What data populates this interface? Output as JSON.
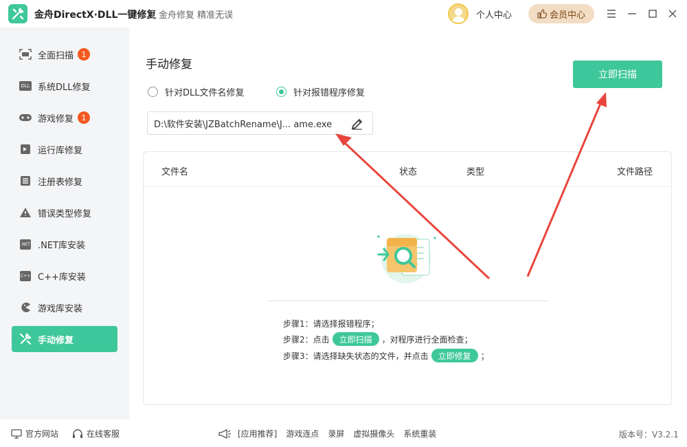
{
  "app": {
    "title": "金舟DirectX·DLL一键修复",
    "slogan": "金舟修复 精准无误",
    "user_center": "个人中心",
    "vip_label": "会员中心"
  },
  "sidebar": {
    "items": [
      {
        "label": "全面扫描",
        "icon": "scan-icon",
        "badge": "1"
      },
      {
        "label": "系统DLL修复",
        "icon": "dll-icon"
      },
      {
        "label": "游戏修复",
        "icon": "gamepad-icon",
        "badge": "1"
      },
      {
        "label": "运行库修复",
        "icon": "runtime-icon"
      },
      {
        "label": "注册表修复",
        "icon": "registry-icon"
      },
      {
        "label": "错误类型修复",
        "icon": "warning-icon"
      },
      {
        "label": ".NET库安装",
        "icon": "dotnet-icon"
      },
      {
        "label": "C++库安装",
        "icon": "cpp-icon"
      },
      {
        "label": "游戏库安装",
        "icon": "pacman-icon"
      },
      {
        "label": "手动修复",
        "icon": "wrench-icon",
        "active": true
      }
    ],
    "icon_texts": {
      "dll": "DLL",
      "net": ".NET",
      "cpp": "C++"
    }
  },
  "main": {
    "title": "手动修复",
    "radio_options": [
      {
        "label": "针对DLL文件名修复",
        "checked": false
      },
      {
        "label": "针对报错程序修复",
        "checked": true
      }
    ],
    "path_value": "D:\\软件安装\\JZBatchRename\\J...  ame.exe",
    "scan_button": "立即扫描",
    "table": {
      "columns": [
        "文件名",
        "状态",
        "类型",
        "文件路径"
      ]
    },
    "steps": {
      "step1": "步骤1：请选择报错程序；",
      "step2_prefix": "步骤2：点击",
      "step2_button": "立即扫描",
      "step2_suffix": "，对程序进行全面检查；",
      "step3_prefix": "步骤3：请选择缺失状态的文件，并点击",
      "step3_button": "立即修复",
      "step3_suffix": "；"
    }
  },
  "footer": {
    "official_site": "官方网站",
    "online_service": "在线客服",
    "recommend": "[应用推荐]",
    "links": [
      "游戏连点",
      "录屏",
      "虚拟摄像头",
      "系统重装"
    ],
    "version": "版本号：V3.2.1"
  },
  "colors": {
    "accent": "#3ec79a",
    "badge": "#f35a1f",
    "arrow": "#e8453c"
  }
}
